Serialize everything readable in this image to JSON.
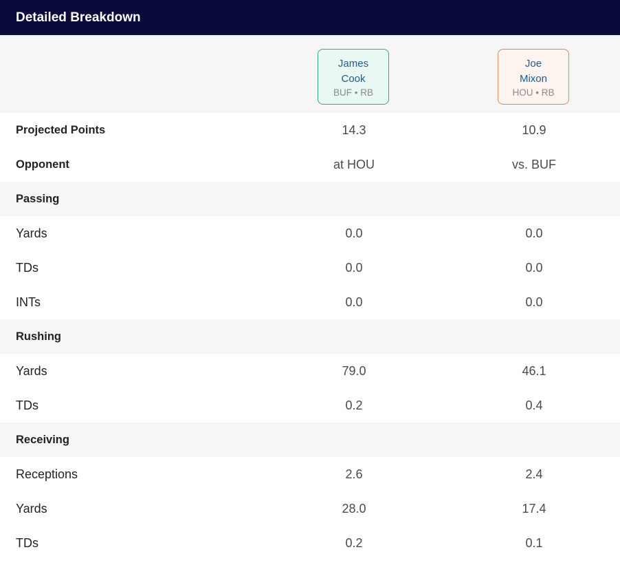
{
  "header": {
    "title": "Detailed Breakdown"
  },
  "players": [
    {
      "first": "James",
      "last": "Cook",
      "team": "BUF",
      "position": "RB",
      "meta": "BUF • RB",
      "accent": "#3aa876"
    },
    {
      "first": "Joe",
      "last": "Mixon",
      "team": "HOU",
      "position": "RB",
      "meta": "HOU • RB",
      "accent": "#d98a55"
    }
  ],
  "rows": [
    {
      "type": "summary",
      "label": "Projected Points",
      "values": [
        "14.3",
        "10.9"
      ]
    },
    {
      "type": "summary",
      "label": "Opponent",
      "values": [
        "at HOU",
        "vs. BUF"
      ]
    },
    {
      "type": "section",
      "label": "Passing",
      "values": [
        "",
        ""
      ]
    },
    {
      "type": "stat",
      "label": "Yards",
      "values": [
        "0.0",
        "0.0"
      ]
    },
    {
      "type": "stat",
      "label": "TDs",
      "values": [
        "0.0",
        "0.0"
      ]
    },
    {
      "type": "stat",
      "label": "INTs",
      "values": [
        "0.0",
        "0.0"
      ]
    },
    {
      "type": "section",
      "label": "Rushing",
      "values": [
        "",
        ""
      ]
    },
    {
      "type": "stat",
      "label": "Yards",
      "values": [
        "79.0",
        "46.1"
      ]
    },
    {
      "type": "stat",
      "label": "TDs",
      "values": [
        "0.2",
        "0.4"
      ]
    },
    {
      "type": "section",
      "label": "Receiving",
      "values": [
        "",
        ""
      ]
    },
    {
      "type": "stat",
      "label": "Receptions",
      "values": [
        "2.6",
        "2.4"
      ]
    },
    {
      "type": "stat",
      "label": "Yards",
      "values": [
        "28.0",
        "17.4"
      ]
    },
    {
      "type": "stat",
      "label": "TDs",
      "values": [
        "0.2",
        "0.1"
      ]
    }
  ]
}
